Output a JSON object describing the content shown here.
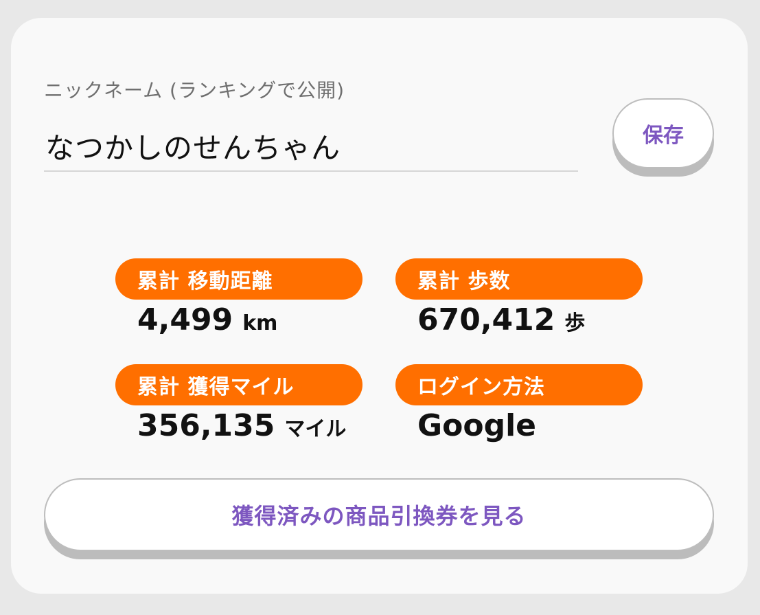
{
  "nickname": {
    "label": "ニックネーム (ランキングで公開)",
    "value": "なつかしのせんちゃん",
    "save_label": "保存"
  },
  "stats": [
    {
      "label": "累計 移動距離",
      "value": "4,499",
      "unit": "km"
    },
    {
      "label": "累計 歩数",
      "value": "670,412",
      "unit": "歩"
    },
    {
      "label": "累計 獲得マイル",
      "value": "356,135",
      "unit": "マイル"
    },
    {
      "label": "ログイン方法",
      "value": "Google",
      "unit": ""
    }
  ],
  "voucher_button_label": "獲得済みの商品引換券を見る",
  "colors": {
    "accent_orange": "#ff6f00",
    "accent_purple": "#7d57c0",
    "card_bg": "#f9f9f9",
    "page_bg": "#e8e8e8"
  }
}
